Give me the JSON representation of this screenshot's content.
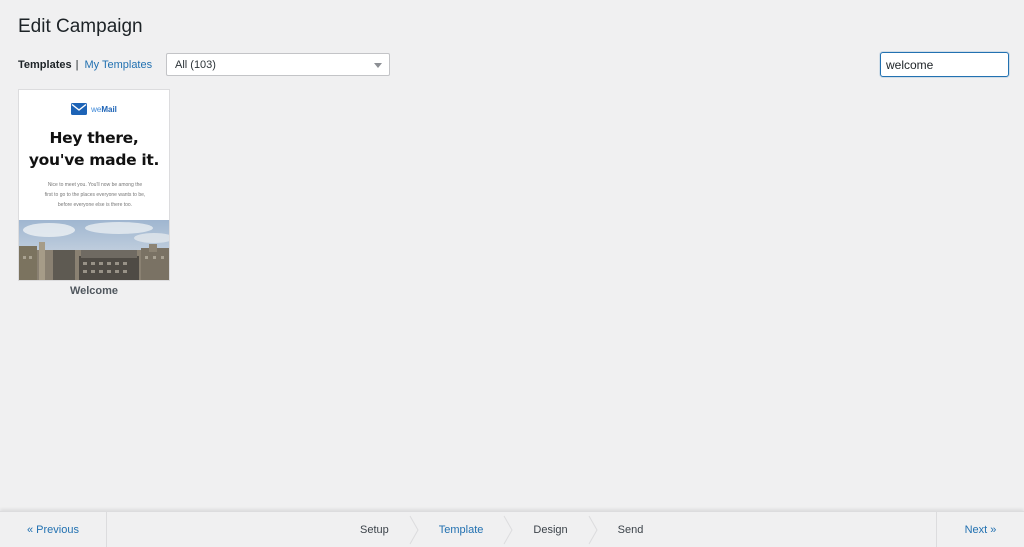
{
  "page": {
    "title": "Edit Campaign"
  },
  "filters": {
    "tab_templates": "Templates",
    "separator": "|",
    "tab_my_templates": "My Templates",
    "category_selected": "All (103)",
    "search_value": "welcome"
  },
  "templates": [
    {
      "name": "Welcome",
      "preview": {
        "brand_prefix": "we",
        "brand_suffix": "Mail",
        "headline_line1": "Hey there,",
        "headline_line2": "you've made it.",
        "body_line1": "Nice to meet you. You'll now be among the",
        "body_line2": "first to go to the places everyone wants to be,",
        "body_line3": "before everyone else is there too."
      }
    }
  ],
  "footer": {
    "previous_label": "« Previous",
    "next_label": "Next »",
    "steps": [
      {
        "label": "Setup",
        "active": false
      },
      {
        "label": "Template",
        "active": true
      },
      {
        "label": "Design",
        "active": false
      },
      {
        "label": "Send",
        "active": false
      }
    ]
  },
  "colors": {
    "accent": "#2271b1",
    "background": "#f0f0f1",
    "brand": "#1d63b6"
  },
  "icons": [
    "envelope-icon",
    "dropdown-caret-icon",
    "step-chevron-icon"
  ]
}
